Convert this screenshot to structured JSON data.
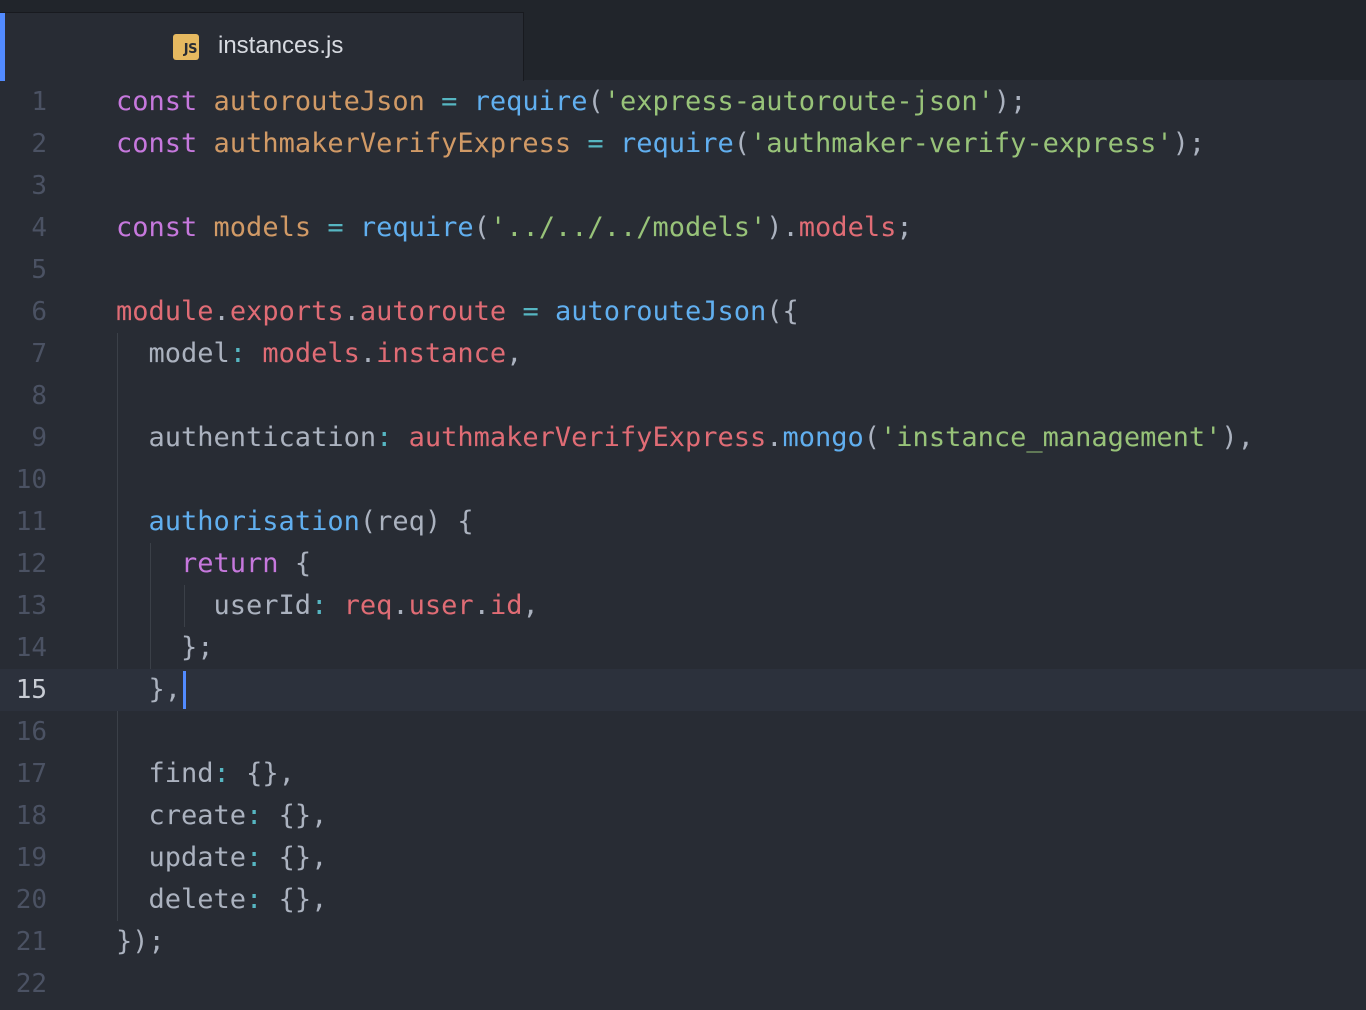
{
  "tab": {
    "icon_text": "JS",
    "filename": "instances.js"
  },
  "editor": {
    "cursor_line": 15,
    "lines": [
      {
        "n": "1",
        "t": [
          [
            "k",
            "const "
          ],
          [
            "d",
            "autorouteJson"
          ],
          [
            "o",
            " = "
          ],
          [
            "f",
            "require"
          ],
          [
            "p",
            "("
          ],
          [
            "s",
            "'express-autoroute-json'"
          ],
          [
            "p",
            ");"
          ]
        ]
      },
      {
        "n": "2",
        "t": [
          [
            "k",
            "const "
          ],
          [
            "d",
            "authmakerVerifyExpress"
          ],
          [
            "o",
            " = "
          ],
          [
            "f",
            "require"
          ],
          [
            "p",
            "("
          ],
          [
            "s",
            "'authmaker-verify-express'"
          ],
          [
            "p",
            ");"
          ]
        ]
      },
      {
        "n": "3",
        "t": []
      },
      {
        "n": "4",
        "t": [
          [
            "k",
            "const "
          ],
          [
            "d",
            "models"
          ],
          [
            "o",
            " = "
          ],
          [
            "f",
            "require"
          ],
          [
            "p",
            "("
          ],
          [
            "s",
            "'../../../models'"
          ],
          [
            "p",
            ")."
          ],
          [
            "r",
            "models"
          ],
          [
            "p",
            ";"
          ]
        ]
      },
      {
        "n": "5",
        "t": []
      },
      {
        "n": "6",
        "t": [
          [
            "r",
            "module"
          ],
          [
            "p",
            "."
          ],
          [
            "r",
            "exports"
          ],
          [
            "p",
            "."
          ],
          [
            "r",
            "autoroute"
          ],
          [
            "o",
            " = "
          ],
          [
            "f",
            "autorouteJson"
          ],
          [
            "p",
            "({"
          ]
        ]
      },
      {
        "n": "7",
        "t": [
          [
            "p",
            "  model"
          ],
          [
            "o",
            ": "
          ],
          [
            "r",
            "models"
          ],
          [
            "p",
            "."
          ],
          [
            "r",
            "instance"
          ],
          [
            "p",
            ","
          ]
        ]
      },
      {
        "n": "8",
        "t": []
      },
      {
        "n": "9",
        "t": [
          [
            "p",
            "  authentication"
          ],
          [
            "o",
            ": "
          ],
          [
            "r",
            "authmakerVerifyExpress"
          ],
          [
            "p",
            "."
          ],
          [
            "f",
            "mongo"
          ],
          [
            "p",
            "("
          ],
          [
            "s",
            "'instance_management'"
          ],
          [
            "p",
            "),"
          ]
        ]
      },
      {
        "n": "10",
        "t": []
      },
      {
        "n": "11",
        "t": [
          [
            "p",
            "  "
          ],
          [
            "f",
            "authorisation"
          ],
          [
            "p",
            "(req) {"
          ]
        ]
      },
      {
        "n": "12",
        "t": [
          [
            "p",
            "    "
          ],
          [
            "k",
            "return"
          ],
          [
            "p",
            " {"
          ]
        ]
      },
      {
        "n": "13",
        "t": [
          [
            "p",
            "      userId"
          ],
          [
            "o",
            ": "
          ],
          [
            "r",
            "req"
          ],
          [
            "p",
            "."
          ],
          [
            "r",
            "user"
          ],
          [
            "p",
            "."
          ],
          [
            "r",
            "id"
          ],
          [
            "p",
            ","
          ]
        ]
      },
      {
        "n": "14",
        "t": [
          [
            "p",
            "    };"
          ]
        ]
      },
      {
        "n": "15",
        "t": [
          [
            "p",
            "  },"
          ]
        ]
      },
      {
        "n": "16",
        "t": []
      },
      {
        "n": "17",
        "t": [
          [
            "p",
            "  find"
          ],
          [
            "o",
            ": "
          ],
          [
            "p",
            "{},"
          ]
        ]
      },
      {
        "n": "18",
        "t": [
          [
            "p",
            "  create"
          ],
          [
            "o",
            ": "
          ],
          [
            "p",
            "{},"
          ]
        ]
      },
      {
        "n": "19",
        "t": [
          [
            "p",
            "  update"
          ],
          [
            "o",
            ": "
          ],
          [
            "p",
            "{},"
          ]
        ]
      },
      {
        "n": "20",
        "t": [
          [
            "p",
            "  delete"
          ],
          [
            "o",
            ": "
          ],
          [
            "p",
            "{},"
          ]
        ]
      },
      {
        "n": "21",
        "t": [
          [
            "p",
            "});"
          ]
        ]
      },
      {
        "n": "22",
        "t": []
      }
    ]
  }
}
